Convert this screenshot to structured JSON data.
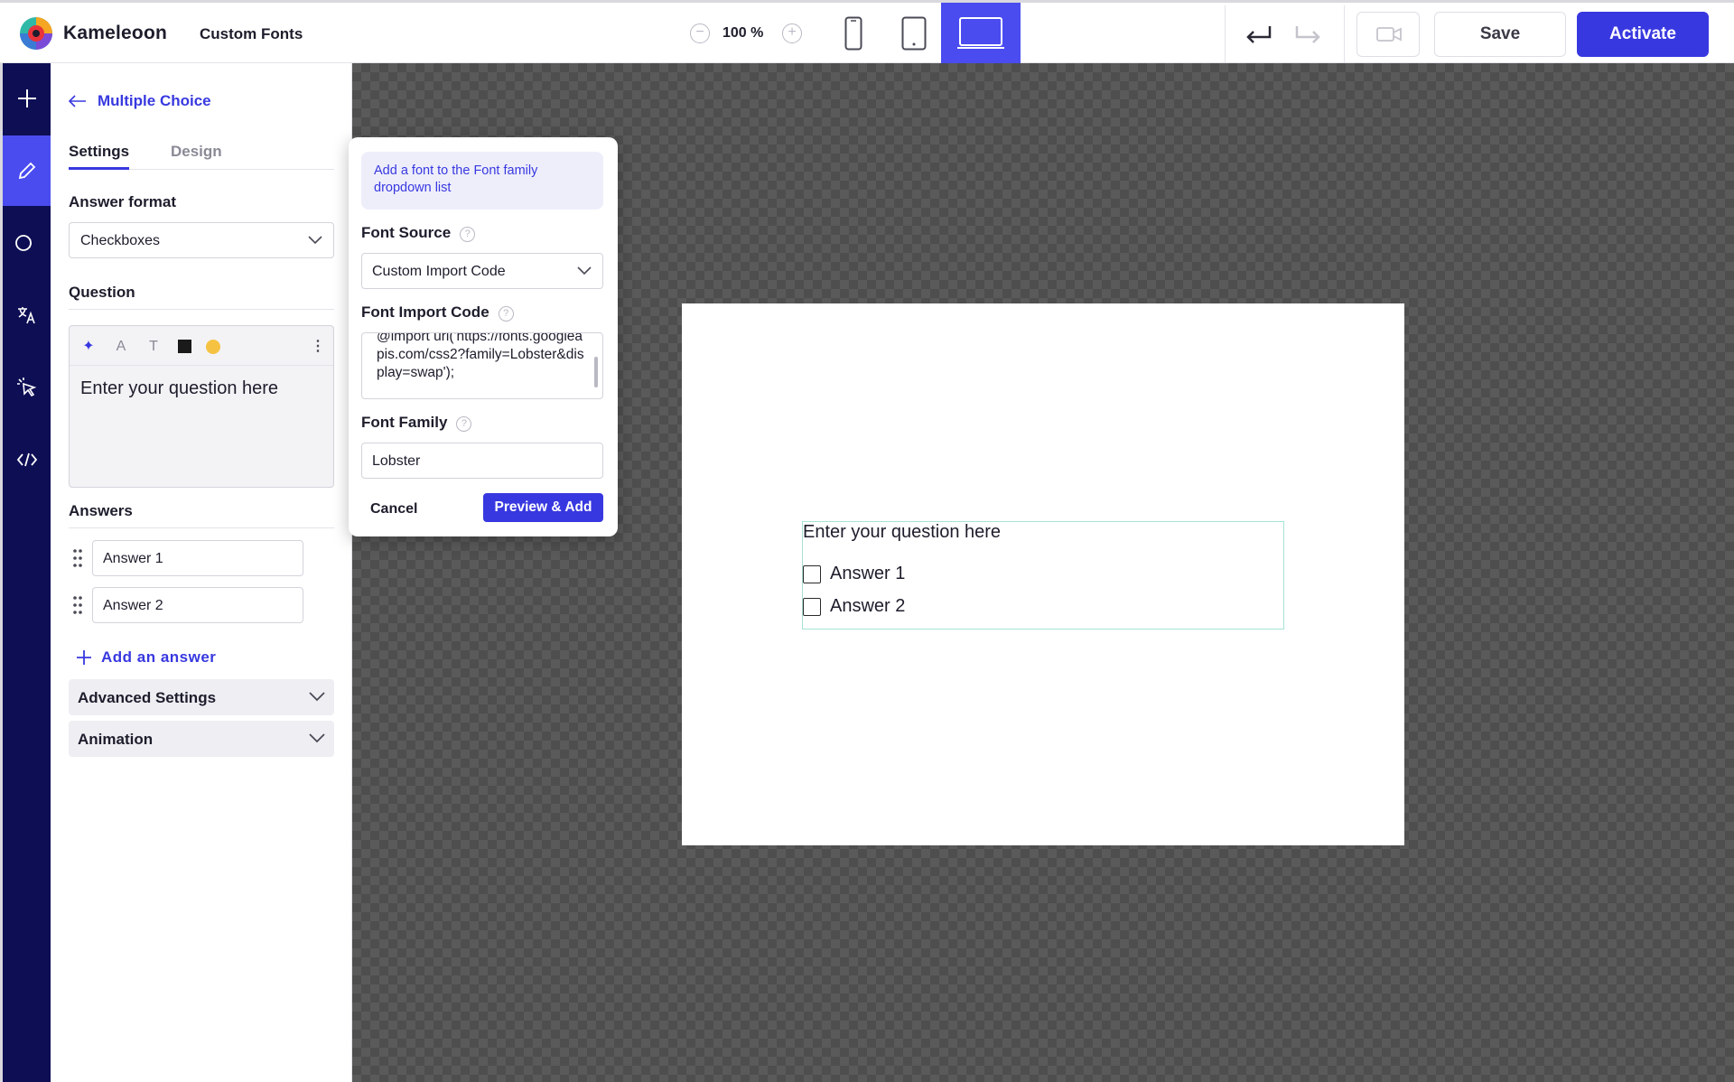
{
  "header": {
    "brand": "Kameleoon",
    "project_title": "Custom Fonts",
    "zoom_level": "100 %",
    "save_label": "Save",
    "activate_label": "Activate",
    "accent_color": "#3838e0"
  },
  "sidebar_rail": {
    "items": [
      "plus-icon",
      "pencil-icon",
      "shapes-icon",
      "translate-icon",
      "pointer-click-icon",
      "code-icon"
    ],
    "active": "pencil-icon"
  },
  "panel": {
    "back_label": "Multiple Choice",
    "tabs": [
      {
        "label": "Settings",
        "active": true
      },
      {
        "label": "Design",
        "active": false
      }
    ],
    "answer_format_label": "Answer format",
    "answer_format_value": "Checkboxes",
    "question_label": "Question",
    "question_text": "Enter your question here",
    "answers_label": "Answers",
    "answers": [
      "Answer 1",
      "Answer 2"
    ],
    "add_answer_label": "Add an answer",
    "advanced_settings_label": "Advanced Settings",
    "animation_label": "Animation"
  },
  "font_popover": {
    "info_text": "Add a font to the Font family dropdown list",
    "font_source_label": "Font Source",
    "font_source_value": "Custom Import Code",
    "font_import_code_label": "Font Import Code",
    "font_import_code_value": "@import url('https://fonts.googleapis.com/css2?family=Lobster&display=swap');",
    "font_family_label": "Font Family",
    "font_family_value": "Lobster",
    "cancel_label": "Cancel",
    "preview_add_label": "Preview & Add"
  },
  "canvas_preview": {
    "question": "Enter your question here",
    "answers": [
      "Answer 1",
      "Answer 2"
    ]
  }
}
